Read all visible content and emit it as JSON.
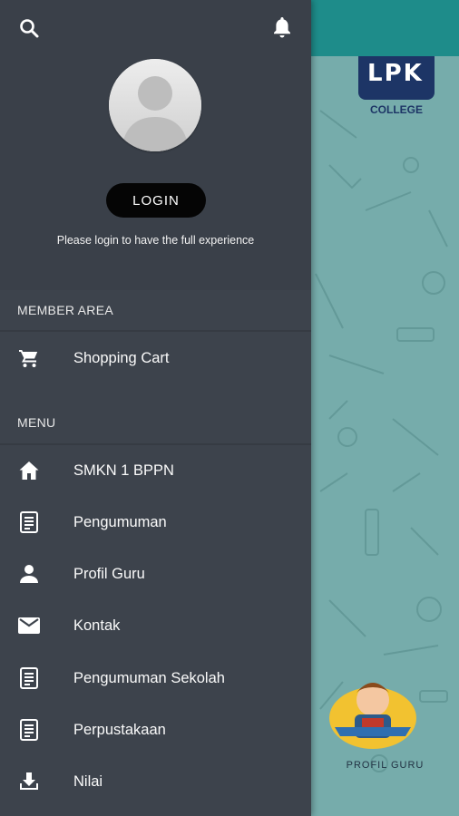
{
  "background": {
    "logo_text": "LPK",
    "logo_sub": "COLLEGE",
    "badge_label": "PROFIL GURU"
  },
  "header": {
    "search_icon": "search-icon",
    "bell_icon": "bell-icon",
    "login_label": "LOGIN",
    "login_hint": "Please login to have the full experience"
  },
  "member_area": {
    "title": "MEMBER AREA",
    "items": [
      {
        "label": "Shopping Cart",
        "icon": "cart-icon"
      }
    ]
  },
  "menu": {
    "title": "MENU",
    "items": [
      {
        "label": "SMKN 1 BPPN",
        "icon": "home-icon"
      },
      {
        "label": "Pengumuman",
        "icon": "document-icon"
      },
      {
        "label": "Profil Guru",
        "icon": "person-icon"
      },
      {
        "label": "Kontak",
        "icon": "mail-icon"
      },
      {
        "label": "Pengumuman Sekolah",
        "icon": "document-icon"
      },
      {
        "label": "Perpustakaan",
        "icon": "document-icon"
      },
      {
        "label": "Nilai",
        "icon": "download-icon"
      }
    ]
  },
  "colors": {
    "drawer": "#3d434c",
    "topbar": "#1e8c8a",
    "pattern": "#76acab"
  }
}
